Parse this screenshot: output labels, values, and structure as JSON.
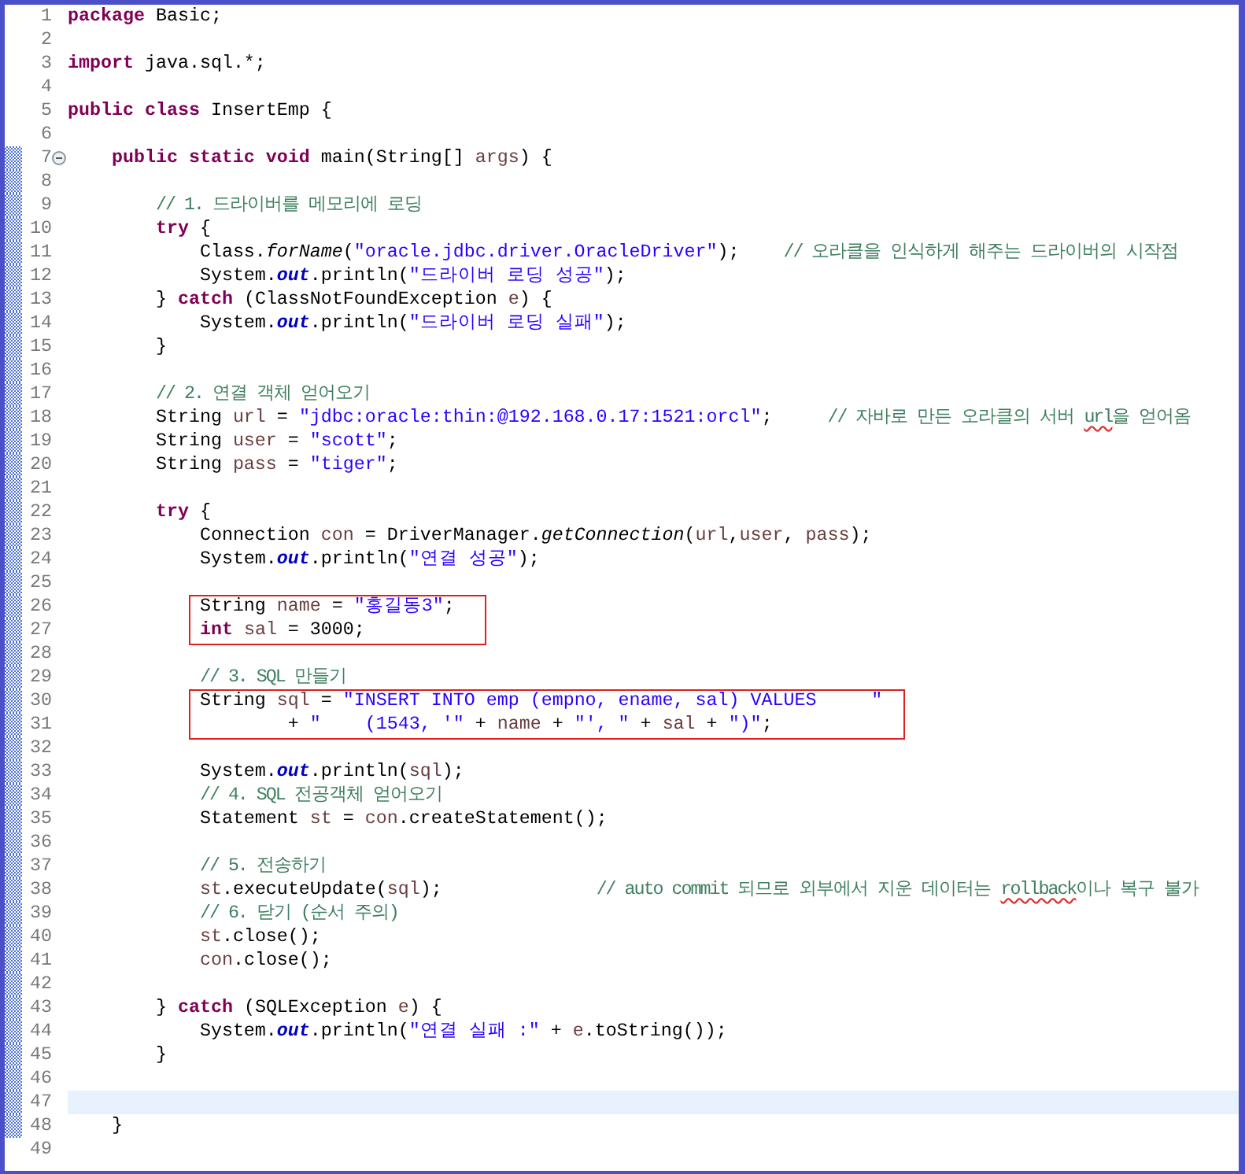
{
  "editor": {
    "items": [
      {
        "kind": "line",
        "number": "1",
        "changed": false,
        "foldable": false,
        "current": false,
        "segments": [
          {
            "kind": "kw",
            "text": "package"
          },
          {
            "kind": "p",
            "text": " Basic;"
          }
        ]
      },
      {
        "kind": "line",
        "number": "2",
        "changed": false,
        "foldable": false,
        "current": false
      },
      {
        "kind": "line",
        "number": "3",
        "changed": false,
        "foldable": false,
        "current": false,
        "segments": [
          {
            "kind": "kw",
            "text": "import"
          },
          {
            "kind": "p",
            "text": " java.sql.*;"
          }
        ]
      },
      {
        "kind": "line",
        "number": "4",
        "changed": false,
        "foldable": false,
        "current": false
      },
      {
        "kind": "line",
        "number": "5",
        "changed": false,
        "foldable": false,
        "current": false,
        "segments": [
          {
            "kind": "kw",
            "text": "public class"
          },
          {
            "kind": "p",
            "text": " InsertEmp {"
          }
        ]
      },
      {
        "kind": "line",
        "number": "6",
        "changed": false,
        "foldable": false,
        "current": false
      },
      {
        "kind": "line",
        "number": "7",
        "changed": true,
        "foldable": true,
        "current": false,
        "segments": [
          {
            "kind": "kw",
            "text": "    public static void"
          },
          {
            "kind": "p",
            "text": " main(String[] "
          },
          {
            "kind": "v",
            "text": "args"
          },
          {
            "kind": "p",
            "text": ") {"
          }
        ]
      },
      {
        "kind": "line",
        "number": "8",
        "changed": true,
        "foldable": false,
        "current": false
      },
      {
        "kind": "line",
        "number": "9",
        "changed": true,
        "foldable": false,
        "current": false,
        "segments": [
          {
            "kind": "c",
            "text": "        // 1. 드라이버를 메모리에 로딩"
          }
        ]
      },
      {
        "kind": "line",
        "number": "10",
        "changed": true,
        "foldable": false,
        "current": false,
        "segments": [
          {
            "kind": "kw",
            "text": "        try"
          },
          {
            "kind": "p",
            "text": " {"
          }
        ]
      },
      {
        "kind": "line",
        "number": "11",
        "changed": true,
        "foldable": false,
        "current": false,
        "segments": [
          {
            "kind": "p",
            "text": "            Class."
          },
          {
            "kind": "sm",
            "text": "forName"
          },
          {
            "kind": "p",
            "text": "("
          },
          {
            "kind": "s",
            "text": "\"oracle.jdbc.driver.OracleDriver\""
          },
          {
            "kind": "p",
            "text": ");    "
          },
          {
            "kind": "c",
            "text": "// 오라클을 인식하게 해주는 드라이버의 시작점"
          }
        ]
      },
      {
        "kind": "line",
        "number": "12",
        "changed": true,
        "foldable": false,
        "current": false,
        "segments": [
          {
            "kind": "p",
            "text": "            System."
          },
          {
            "kind": "f",
            "text": "out"
          },
          {
            "kind": "p",
            "text": ".println("
          },
          {
            "kind": "s",
            "text": "\"드라이버 로딩 성공\""
          },
          {
            "kind": "p",
            "text": ");"
          }
        ]
      },
      {
        "kind": "line",
        "number": "13",
        "changed": true,
        "foldable": false,
        "current": false,
        "segments": [
          {
            "kind": "p",
            "text": "        } "
          },
          {
            "kind": "kw",
            "text": "catch"
          },
          {
            "kind": "p",
            "text": " (ClassNotFoundException "
          },
          {
            "kind": "v",
            "text": "e"
          },
          {
            "kind": "p",
            "text": ") {"
          }
        ]
      },
      {
        "kind": "line",
        "number": "14",
        "changed": true,
        "foldable": false,
        "current": false,
        "segments": [
          {
            "kind": "p",
            "text": "            System."
          },
          {
            "kind": "f",
            "text": "out"
          },
          {
            "kind": "p",
            "text": ".println("
          },
          {
            "kind": "s",
            "text": "\"드라이버 로딩 실패\""
          },
          {
            "kind": "p",
            "text": ");"
          }
        ]
      },
      {
        "kind": "line",
        "number": "15",
        "changed": true,
        "foldable": false,
        "current": false,
        "segments": [
          {
            "kind": "p",
            "text": "        }"
          }
        ]
      },
      {
        "kind": "line",
        "number": "16",
        "changed": true,
        "foldable": false,
        "current": false
      },
      {
        "kind": "line",
        "number": "17",
        "changed": true,
        "foldable": false,
        "current": false,
        "segments": [
          {
            "kind": "c",
            "text": "        // 2. 연결 객체 얻어오기"
          }
        ]
      },
      {
        "kind": "line",
        "number": "18",
        "changed": true,
        "foldable": false,
        "current": false,
        "segments": [
          {
            "kind": "p",
            "text": "        String "
          },
          {
            "kind": "v",
            "text": "url"
          },
          {
            "kind": "p",
            "text": " = "
          },
          {
            "kind": "s",
            "text": "\"jdbc:oracle:thin:@192.168.0.17:1521:orcl\""
          },
          {
            "kind": "p",
            "text": ";     "
          },
          {
            "kind": "c",
            "text": "// 자바로 만든 오라클의 서버 "
          },
          {
            "kind": "cm",
            "text": "url"
          },
          {
            "kind": "c",
            "text": "을 얻어옴"
          }
        ]
      },
      {
        "kind": "line",
        "number": "19",
        "changed": true,
        "foldable": false,
        "current": false,
        "segments": [
          {
            "kind": "p",
            "text": "        String "
          },
          {
            "kind": "v",
            "text": "user"
          },
          {
            "kind": "p",
            "text": " = "
          },
          {
            "kind": "s",
            "text": "\"scott\""
          },
          {
            "kind": "p",
            "text": ";"
          }
        ]
      },
      {
        "kind": "line",
        "number": "20",
        "changed": true,
        "foldable": false,
        "current": false,
        "segments": [
          {
            "kind": "p",
            "text": "        String "
          },
          {
            "kind": "v",
            "text": "pass"
          },
          {
            "kind": "p",
            "text": " = "
          },
          {
            "kind": "s",
            "text": "\"tiger\""
          },
          {
            "kind": "p",
            "text": ";"
          }
        ]
      },
      {
        "kind": "line",
        "number": "21",
        "changed": true,
        "foldable": false,
        "current": false
      },
      {
        "kind": "line",
        "number": "22",
        "changed": true,
        "foldable": false,
        "current": false,
        "segments": [
          {
            "kind": "kw",
            "text": "        try"
          },
          {
            "kind": "p",
            "text": " {"
          }
        ]
      },
      {
        "kind": "line",
        "number": "23",
        "changed": true,
        "foldable": false,
        "current": false,
        "segments": [
          {
            "kind": "p",
            "text": "            Connection "
          },
          {
            "kind": "v",
            "text": "con"
          },
          {
            "kind": "p",
            "text": " = DriverManager."
          },
          {
            "kind": "sm",
            "text": "getConnection"
          },
          {
            "kind": "p",
            "text": "("
          },
          {
            "kind": "v",
            "text": "url"
          },
          {
            "kind": "p",
            "text": ","
          },
          {
            "kind": "v",
            "text": "user"
          },
          {
            "kind": "p",
            "text": ", "
          },
          {
            "kind": "v",
            "text": "pass"
          },
          {
            "kind": "p",
            "text": ");"
          }
        ]
      },
      {
        "kind": "line",
        "number": "24",
        "changed": true,
        "foldable": false,
        "current": false,
        "segments": [
          {
            "kind": "p",
            "text": "            System."
          },
          {
            "kind": "f",
            "text": "out"
          },
          {
            "kind": "p",
            "text": ".println("
          },
          {
            "kind": "s",
            "text": "\"연결 성공\""
          },
          {
            "kind": "p",
            "text": ");"
          }
        ]
      },
      {
        "kind": "line",
        "number": "25",
        "changed": true,
        "foldable": false,
        "current": false
      },
      {
        "kind": "boxed",
        "lines": [
          {
            "kind": "line",
            "number": "26",
            "changed": true,
            "foldable": false,
            "current": false,
            "segments": [
              {
                "kind": "p",
                "text": "            String "
              },
              {
                "kind": "v",
                "text": "name"
              },
              {
                "kind": "p",
                "text": " = "
              },
              {
                "kind": "s",
                "text": "\"홍길동3\""
              },
              {
                "kind": "p",
                "text": ";"
              }
            ]
          },
          {
            "kind": "line",
            "number": "27",
            "changed": true,
            "foldable": false,
            "current": false,
            "segments": [
              {
                "kind": "kw",
                "text": "            int"
              },
              {
                "kind": "v",
                "text": " sal"
              },
              {
                "kind": "p",
                "text": " = 3000;"
              }
            ]
          }
        ]
      },
      {
        "kind": "line",
        "number": "28",
        "changed": true,
        "foldable": false,
        "current": false
      },
      {
        "kind": "line",
        "number": "29",
        "changed": true,
        "foldable": false,
        "current": false,
        "segments": [
          {
            "kind": "c",
            "text": "            // 3. SQL 만들기"
          }
        ]
      },
      {
        "kind": "boxed",
        "lines": [
          {
            "kind": "line",
            "number": "30",
            "changed": true,
            "foldable": false,
            "current": false,
            "segments": [
              {
                "kind": "p",
                "text": "            String "
              },
              {
                "kind": "v",
                "text": "sql"
              },
              {
                "kind": "p",
                "text": " = "
              },
              {
                "kind": "s",
                "text": "\"INSERT INTO emp (empno, ename, sal) VALUES     \""
              }
            ]
          },
          {
            "kind": "line",
            "number": "31",
            "changed": true,
            "foldable": false,
            "current": false,
            "segments": [
              {
                "kind": "p",
                "text": "                    + "
              },
              {
                "kind": "s",
                "text": "\"    (1543, '\""
              },
              {
                "kind": "p",
                "text": " + "
              },
              {
                "kind": "v",
                "text": "name"
              },
              {
                "kind": "p",
                "text": " + "
              },
              {
                "kind": "s",
                "text": "\"', \""
              },
              {
                "kind": "p",
                "text": " + "
              },
              {
                "kind": "v",
                "text": "sal"
              },
              {
                "kind": "p",
                "text": " + "
              },
              {
                "kind": "s",
                "text": "\")\""
              },
              {
                "kind": "p",
                "text": ";"
              }
            ]
          }
        ]
      },
      {
        "kind": "line",
        "number": "32",
        "changed": true,
        "foldable": false,
        "current": false
      },
      {
        "kind": "line",
        "number": "33",
        "changed": true,
        "foldable": false,
        "current": false,
        "segments": [
          {
            "kind": "p",
            "text": "            System."
          },
          {
            "kind": "f",
            "text": "out"
          },
          {
            "kind": "p",
            "text": ".println("
          },
          {
            "kind": "v",
            "text": "sql"
          },
          {
            "kind": "p",
            "text": ");"
          }
        ]
      },
      {
        "kind": "line",
        "number": "34",
        "changed": true,
        "foldable": false,
        "current": false,
        "segments": [
          {
            "kind": "c",
            "text": "            // 4. SQL 전공객체 얻어오기"
          }
        ]
      },
      {
        "kind": "line",
        "number": "35",
        "changed": true,
        "foldable": false,
        "current": false,
        "segments": [
          {
            "kind": "p",
            "text": "            Statement "
          },
          {
            "kind": "v",
            "text": "st"
          },
          {
            "kind": "p",
            "text": " = "
          },
          {
            "kind": "v",
            "text": "con"
          },
          {
            "kind": "p",
            "text": ".createStatement();"
          }
        ]
      },
      {
        "kind": "line",
        "number": "36",
        "changed": true,
        "foldable": false,
        "current": false
      },
      {
        "kind": "line",
        "number": "37",
        "changed": true,
        "foldable": false,
        "current": false,
        "segments": [
          {
            "kind": "c",
            "text": "            // 5. 전송하기"
          }
        ]
      },
      {
        "kind": "line",
        "number": "38",
        "changed": true,
        "foldable": false,
        "current": false,
        "segments": [
          {
            "kind": "v",
            "text": "            st"
          },
          {
            "kind": "p",
            "text": ".executeUpdate("
          },
          {
            "kind": "v",
            "text": "sql"
          },
          {
            "kind": "p",
            "text": ");              "
          },
          {
            "kind": "c",
            "text": "// auto commit 되므로 외부에서 지운 데이터는 "
          },
          {
            "kind": "cm",
            "text": "rollback"
          },
          {
            "kind": "c",
            "text": "이나 복구 불가"
          }
        ]
      },
      {
        "kind": "line",
        "number": "39",
        "changed": true,
        "foldable": false,
        "current": false,
        "segments": [
          {
            "kind": "c",
            "text": "            // 6. 닫기 (순서 주의)"
          }
        ]
      },
      {
        "kind": "line",
        "number": "40",
        "changed": true,
        "foldable": false,
        "current": false,
        "segments": [
          {
            "kind": "v",
            "text": "            st"
          },
          {
            "kind": "p",
            "text": ".close();"
          }
        ]
      },
      {
        "kind": "line",
        "number": "41",
        "changed": true,
        "foldable": false,
        "current": false,
        "segments": [
          {
            "kind": "v",
            "text": "            con"
          },
          {
            "kind": "p",
            "text": ".close();"
          }
        ]
      },
      {
        "kind": "line",
        "number": "42",
        "changed": true,
        "foldable": false,
        "current": false
      },
      {
        "kind": "line",
        "number": "43",
        "changed": true,
        "foldable": false,
        "current": false,
        "segments": [
          {
            "kind": "p",
            "text": "        } "
          },
          {
            "kind": "kw",
            "text": "catch"
          },
          {
            "kind": "p",
            "text": " (SQLException "
          },
          {
            "kind": "v",
            "text": "e"
          },
          {
            "kind": "p",
            "text": ") {"
          }
        ]
      },
      {
        "kind": "line",
        "number": "44",
        "changed": true,
        "foldable": false,
        "current": false,
        "segments": [
          {
            "kind": "p",
            "text": "            System."
          },
          {
            "kind": "f",
            "text": "out"
          },
          {
            "kind": "p",
            "text": ".println("
          },
          {
            "kind": "s",
            "text": "\"연결 실패 :\""
          },
          {
            "kind": "p",
            "text": " + "
          },
          {
            "kind": "v",
            "text": "e"
          },
          {
            "kind": "p",
            "text": ".toString());"
          }
        ]
      },
      {
        "kind": "line",
        "number": "45",
        "changed": true,
        "foldable": false,
        "current": false,
        "segments": [
          {
            "kind": "p",
            "text": "        }"
          }
        ]
      },
      {
        "kind": "line",
        "number": "46",
        "changed": true,
        "foldable": false,
        "current": false
      },
      {
        "kind": "line",
        "number": "47",
        "changed": true,
        "foldable": false,
        "current": true
      },
      {
        "kind": "line",
        "number": "48",
        "changed": true,
        "foldable": false,
        "current": false,
        "segments": [
          {
            "kind": "p",
            "text": "    }"
          }
        ]
      },
      {
        "kind": "line",
        "number": "49",
        "changed": false,
        "foldable": false,
        "current": false
      }
    ]
  }
}
